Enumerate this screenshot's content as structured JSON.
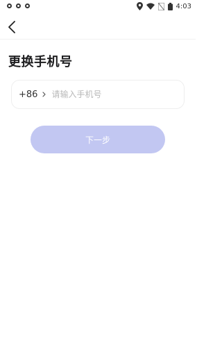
{
  "status_bar": {
    "time": "4:03",
    "icons": [
      "location-icon",
      "wifi-icon",
      "no-sim-icon",
      "battery-icon"
    ]
  },
  "header": {
    "back_icon": "chevron-left-icon"
  },
  "page": {
    "title": "更换手机号"
  },
  "phone_field": {
    "country_code": "+86",
    "placeholder": "请输入手机号",
    "value": ""
  },
  "next_button": {
    "label": "下一步",
    "color": "#c2c7f2",
    "text_color": "#ffffff"
  }
}
